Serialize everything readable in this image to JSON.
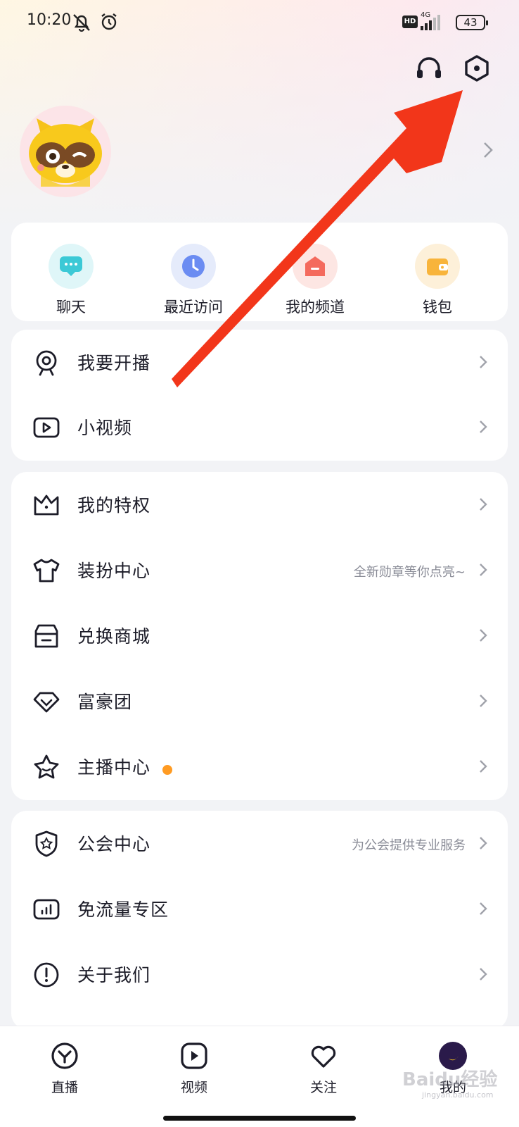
{
  "status_bar": {
    "time": "10:20",
    "network": "4G",
    "hd": "HD",
    "battery": "43"
  },
  "quick_actions": [
    {
      "label": "聊天",
      "icon": "chat-icon",
      "color": "#3cc9d6"
    },
    {
      "label": "最近访问",
      "icon": "clock-icon",
      "color": "#6b8cf2"
    },
    {
      "label": "我的频道",
      "icon": "channel-icon",
      "color": "#f46a5d"
    },
    {
      "label": "钱包",
      "icon": "wallet-icon",
      "color": "#f8b43b"
    }
  ],
  "sections": {
    "live": [
      {
        "label": "我要开播",
        "icon": "webcam-icon"
      },
      {
        "label": "小视频",
        "icon": "video-icon"
      }
    ],
    "privileges": [
      {
        "label": "我的特权",
        "icon": "crown-icon"
      },
      {
        "label": "装扮中心",
        "icon": "shirt-icon",
        "subtitle": "全新勋章等你点亮~"
      },
      {
        "label": "兑换商城",
        "icon": "store-icon"
      },
      {
        "label": "富豪团",
        "icon": "diamond-icon"
      },
      {
        "label": "主播中心",
        "icon": "star-icon",
        "dot": true
      }
    ],
    "more": [
      {
        "label": "公会中心",
        "icon": "shield-star-icon",
        "subtitle": "为公会提供专业服务"
      },
      {
        "label": "免流量专区",
        "icon": "data-free-icon"
      },
      {
        "label": "关于我们",
        "icon": "info-icon"
      }
    ]
  },
  "bottom_nav": [
    {
      "label": "直播",
      "icon": "live-tab-icon"
    },
    {
      "label": "视频",
      "icon": "video-tab-icon"
    },
    {
      "label": "关注",
      "icon": "heart-tab-icon"
    },
    {
      "label": "我的",
      "icon": "me-tab-icon"
    }
  ],
  "watermark": {
    "brand": "Baidu经验",
    "url": "jingyan.baidu.com"
  },
  "colors": {
    "accent_dot": "#ff9b22",
    "arrow": "#f2361a"
  }
}
